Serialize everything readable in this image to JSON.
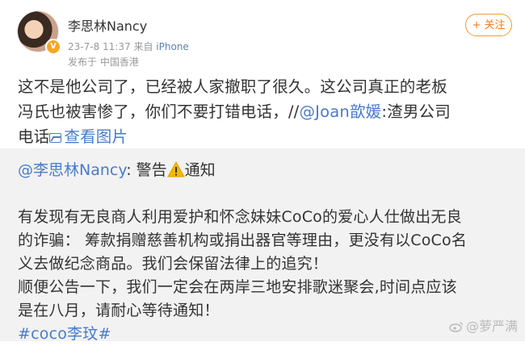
{
  "user": {
    "name": "李思林Nancy",
    "date": "23-7-8 11:37",
    "source_prefix": "来自",
    "source": "iPhone",
    "location": "发布于 中国香港"
  },
  "follow_button": {
    "label": "+ 关注"
  },
  "post": {
    "line1": "这不是他公司了，已经被人家撤职了很久。这公司真正的老板",
    "line2_text": "冯氏也被害惨了，你们不要打错电话，//",
    "line2_mention": "@Joan歆媛",
    "line2_tail": ":渣男公司",
    "line3_text": "电话",
    "view_pictures": "查看图片"
  },
  "repost": {
    "author_mention": "@李思林Nancy",
    "author_sep": ": 警告",
    "author_tail": "通知",
    "body_lines": [
      "有发现有无良商人利用爱护和怀念妹妹CoCo的爱心人仕做出无良",
      "的诈骗： 筹款捐赠慈善机构或捐出器官等理由，更没有以CoCo名",
      "义去做纪念商品。我们会保留法律上的追究！",
      "顺便公告一下，我们一定会在两岸三地安排歌迷聚会,时间点应该",
      "是在八月，请耐心等待通知！"
    ],
    "hashtag": "#coco李玟#"
  },
  "watermark": {
    "text": "@萝严满"
  },
  "colors": {
    "link": "#4a7bc8",
    "follow": "#f07c1e",
    "repost_bg": "#f2f2f2",
    "warning": "#f5b800"
  },
  "icons": {
    "avatar": "profile-photo",
    "badge": "verified-v-icon",
    "pictures": "image-icon",
    "warning": "warning-triangle-icon",
    "watermark": "weibo-logo-icon"
  }
}
